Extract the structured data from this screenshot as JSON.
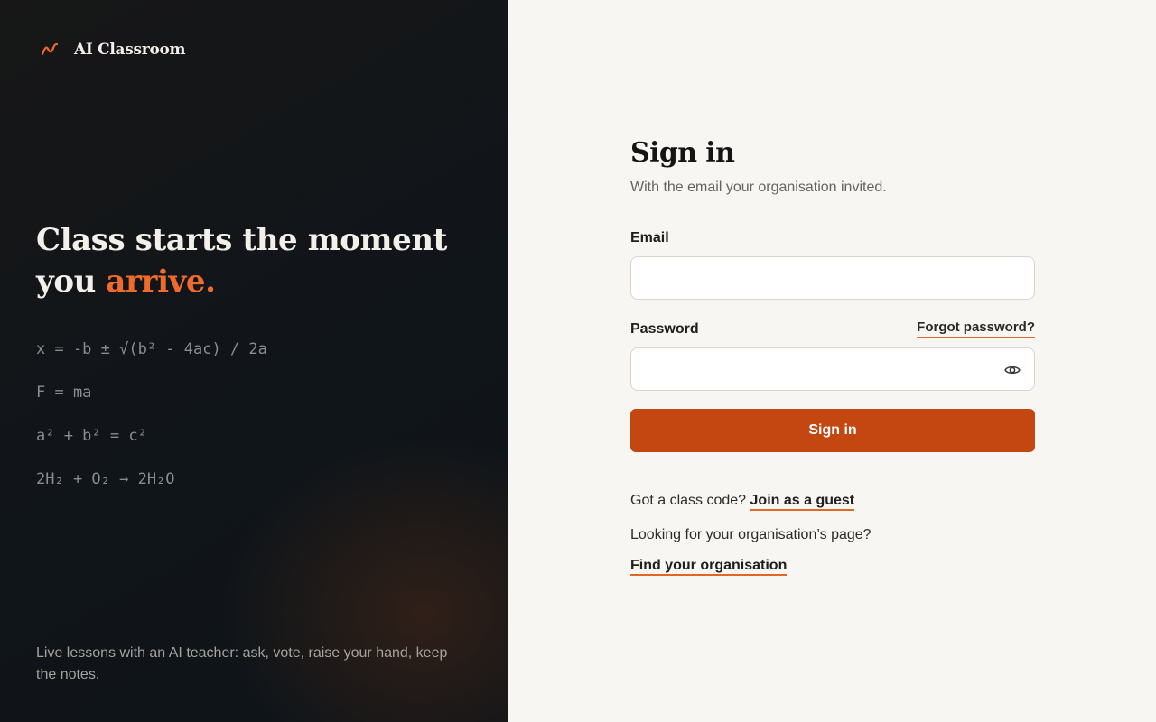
{
  "brand": {
    "name": "AI Classroom",
    "icon": "squiggle-logo-icon",
    "accent_color": "#ef6a2d"
  },
  "hero": {
    "headline_line1": "Class starts the moment",
    "headline_line2_prefix": "you",
    "headline_accent": "arrive.",
    "formulas": [
      "x = -b ± √(b² - 4ac) / 2a",
      "F = ma",
      "a² + b² = c²",
      "2H₂ + O₂ → 2H₂O"
    ],
    "tagline": "Live lessons with an AI teacher: ask, vote, raise your hand, keep the notes."
  },
  "form": {
    "title": "Sign in",
    "subtitle": "With the email your organisation invited.",
    "email_label": "Email",
    "email_value": "",
    "password_label": "Password",
    "password_value": "",
    "forgot_label": "Forgot password?",
    "show_password_icon": "eye-icon",
    "submit_label": "Sign in",
    "submit_color": "#c44711"
  },
  "footer_links": {
    "guest_prompt": "Got a class code?",
    "guest_link": "Join as a guest",
    "org_prompt": "Looking for your organisation’s page?",
    "org_link": "Find your organisation"
  }
}
